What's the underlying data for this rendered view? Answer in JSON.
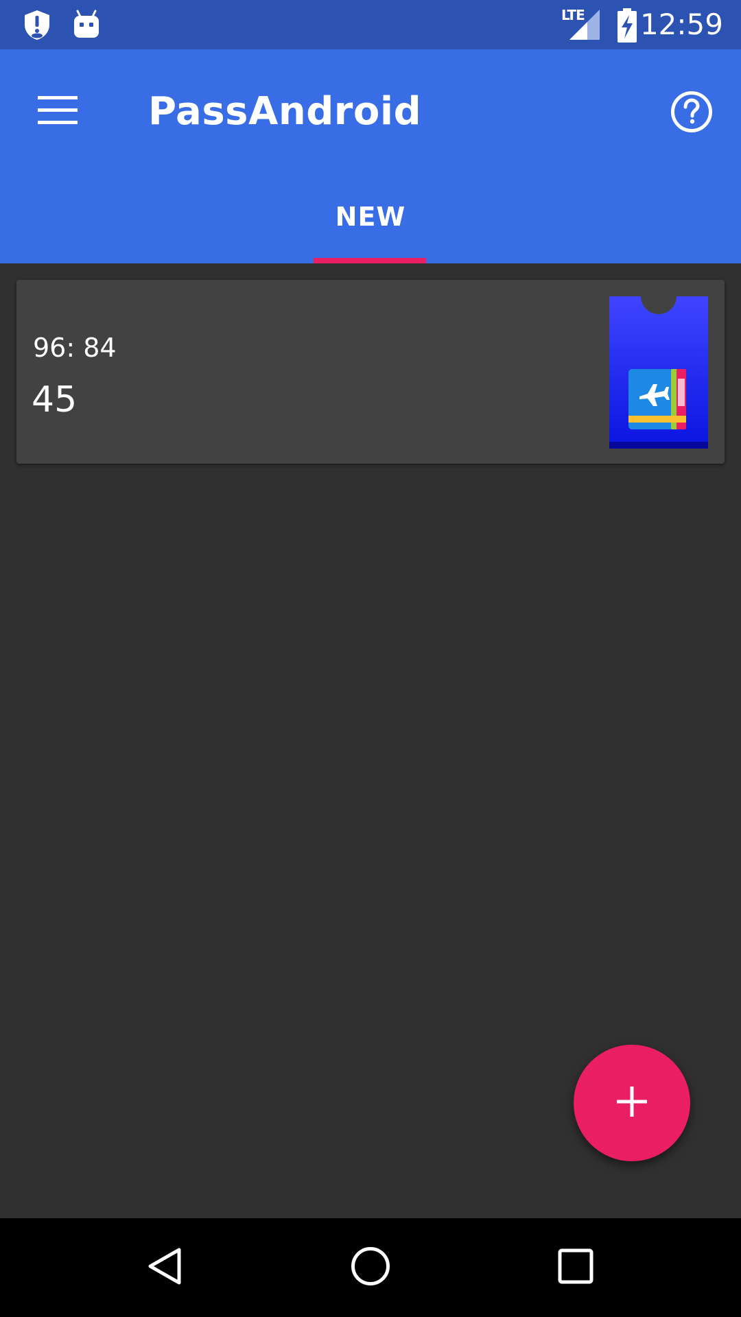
{
  "status_bar": {
    "time": "12:59",
    "network_label": "LTE",
    "icons": [
      "vpn-shield-icon",
      "android-debug-icon",
      "lte-signal-icon",
      "battery-charging-icon"
    ]
  },
  "app_bar": {
    "title": "PassAndroid",
    "menu_icon": "hamburger-menu-icon",
    "help_icon": "help-circle-icon"
  },
  "tabs": [
    {
      "label": "NEW",
      "selected": true
    }
  ],
  "passes": [
    {
      "line1": "96: 84",
      "line2": "45",
      "thumbnail_icon": "boarding-pass-icon"
    }
  ],
  "fab": {
    "label": "+",
    "icon": "add-icon"
  },
  "nav_bar": {
    "icons": [
      "back-icon",
      "home-icon",
      "recents-icon"
    ]
  },
  "colors": {
    "status_bar": "#2c53b1",
    "app_bar": "#386de6",
    "accent": "#e91e63",
    "background": "#303030",
    "card": "#424242"
  }
}
